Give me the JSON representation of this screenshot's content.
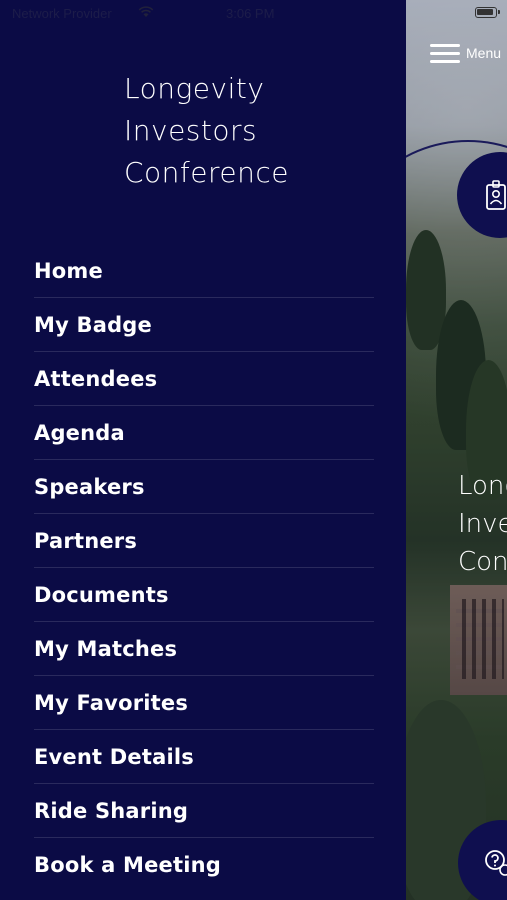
{
  "status_bar": {
    "carrier": "Network Provider",
    "time": "3:06 PM"
  },
  "drawer": {
    "title_lines": [
      "Longevity",
      "Investors",
      "Conference"
    ],
    "items": [
      {
        "label": "Home"
      },
      {
        "label": "My Badge"
      },
      {
        "label": "Attendees"
      },
      {
        "label": "Agenda"
      },
      {
        "label": "Speakers"
      },
      {
        "label": "Partners"
      },
      {
        "label": "Documents"
      },
      {
        "label": "My Matches"
      },
      {
        "label": "My Favorites"
      },
      {
        "label": "Event Details"
      },
      {
        "label": "Ride Sharing"
      },
      {
        "label": "Book a Meeting"
      }
    ]
  },
  "background_screen": {
    "menu_label": "Menu",
    "title_lines": [
      "Long",
      "Inve",
      "Con"
    ]
  },
  "colors": {
    "drawer_bg": "#0b0b45",
    "button_bg": "#0f0f4f",
    "text": "#ffffff"
  },
  "icons": [
    "wifi-icon",
    "battery-icon",
    "hamburger-icon",
    "badge-icon",
    "help-icon"
  ]
}
